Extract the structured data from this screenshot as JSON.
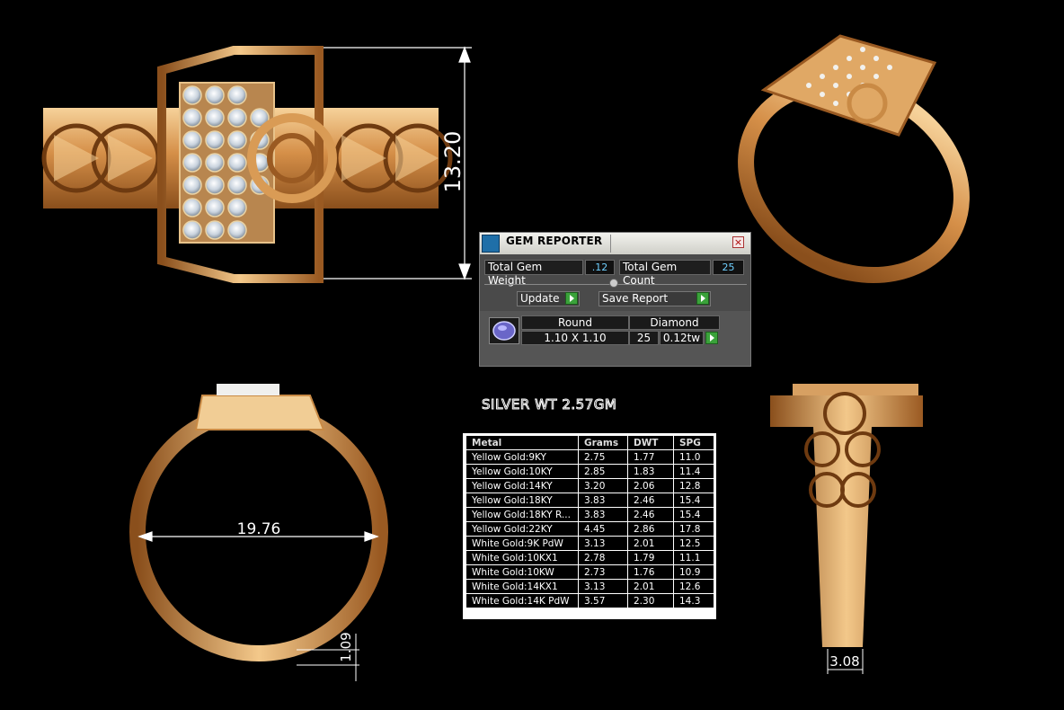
{
  "dimensions": {
    "height": "13.20",
    "inner_diameter": "19.76",
    "bottom_thickness": "1.09",
    "shank_width": "3.08"
  },
  "gem_reporter": {
    "title": "GEM REPORTER",
    "close_glyph": "×",
    "total_gem_weight_label": "Total Gem Weight",
    "total_gem_weight_value": ".12",
    "total_gem_count_label": "Total Gem Count",
    "total_gem_count_value": "25",
    "update_label": "Update",
    "save_report_label": "Save Report",
    "gem": {
      "shape": "Round",
      "type": "Diamond",
      "size": "1.10 X 1.10",
      "count": "25",
      "weight": "0.12tw"
    }
  },
  "silver_weight": "SILVER WT 2.57GM",
  "metal_table": {
    "headers": [
      "Metal",
      "Grams",
      "DWT",
      "SPG"
    ],
    "rows": [
      [
        "Yellow Gold:9KY",
        "2.75",
        "1.77",
        "11.0"
      ],
      [
        "Yellow Gold:10KY",
        "2.85",
        "1.83",
        "11.4"
      ],
      [
        "Yellow Gold:14KY",
        "3.20",
        "2.06",
        "12.8"
      ],
      [
        "Yellow Gold:18KY",
        "3.83",
        "2.46",
        "15.4"
      ],
      [
        "Yellow Gold:18KY R...",
        "3.83",
        "2.46",
        "15.4"
      ],
      [
        "Yellow Gold:22KY",
        "4.45",
        "2.86",
        "17.8"
      ],
      [
        "White Gold:9K PdW",
        "3.13",
        "2.01",
        "12.5"
      ],
      [
        "White Gold:10KX1",
        "2.78",
        "1.79",
        "11.1"
      ],
      [
        "White Gold:10KW",
        "2.73",
        "1.76",
        "10.9"
      ],
      [
        "White Gold:14KX1",
        "3.13",
        "2.01",
        "12.6"
      ],
      [
        "White Gold:14K PdW",
        "3.57",
        "2.30",
        "14.3"
      ]
    ]
  },
  "colors": {
    "gold_light": "#f3c88a",
    "gold_mid": "#d9954f",
    "gold_dark": "#8a4f1c",
    "gem": "#dfe6ee",
    "arrow_green": "#3aa23a",
    "value_blue": "#6fd0ff"
  }
}
